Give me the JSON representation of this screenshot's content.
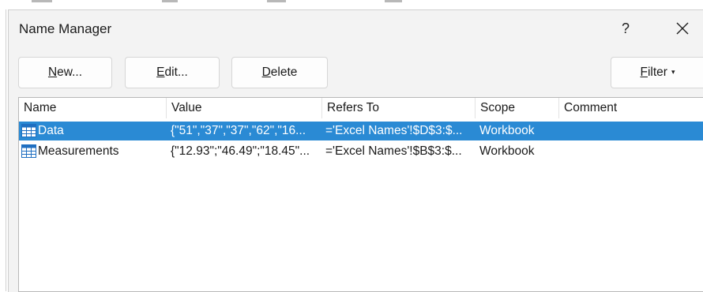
{
  "dialog": {
    "title": "Name Manager",
    "help_label": "?"
  },
  "toolbar": {
    "new_label_mnemonic": "N",
    "new_label_rest": "ew...",
    "edit_label_mnemonic": "E",
    "edit_label_rest": "dit...",
    "delete_label_mnemonic": "D",
    "delete_label_rest": "elete",
    "filter_label_mnemonic": "F",
    "filter_label_rest": "ilter",
    "filter_caret": "▾"
  },
  "table": {
    "columns": [
      "Name",
      "Value",
      "Refers To",
      "Scope",
      "Comment"
    ],
    "rows": [
      {
        "name": "Data",
        "value": "{\"51\",\"37\",\"37\",\"62\",\"16...",
        "refers_to": "='Excel Names'!$D$3:$...",
        "scope": "Workbook",
        "comment": "",
        "selected": true,
        "icon": "table-name-icon"
      },
      {
        "name": "Measurements",
        "value": "{\"12.93\";\"46.49\";\"18.45\"...",
        "refers_to": "='Excel Names'!$B$3:$...",
        "scope": "Workbook",
        "comment": "",
        "selected": false,
        "icon": "table-name-icon"
      }
    ]
  },
  "colors": {
    "selection": "#2a8ad4",
    "dialog_bg": "#f3f3f3",
    "icon_blue": "#1f6fc1"
  }
}
